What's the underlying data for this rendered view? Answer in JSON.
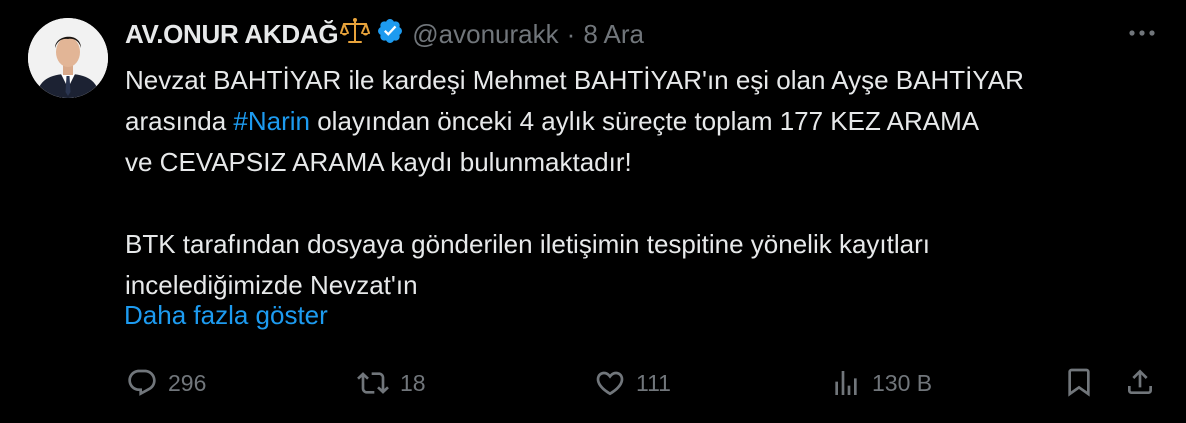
{
  "tweet": {
    "author_name": "AV.ONUR AKDAĞ",
    "handle": "@avonurakk",
    "separator": "·",
    "date": "8 Ara",
    "text_lines": [
      "Nevzat BAHTİYAR ile kardeşi Mehmet BAHTİYAR'ın eşi olan Ayşe BAHTİYAR",
      "arasında ",
      "#Narin",
      " olayından önceki 4 aylık süreçte toplam 177 KEZ ARAMA",
      "ve CEVAPSIZ ARAMA kaydı bulunmaktadır!",
      "BTK tarafından dosyaya gönderilen iletişimin tespitine yönelik kayıtları",
      "incelediğimizde Nevzat'ın"
    ],
    "show_more": "Daha fazla göster",
    "stats": {
      "replies": "296",
      "retweets": "18",
      "likes": "111",
      "views": "130 B"
    }
  },
  "colors": {
    "background": "#000000",
    "text": "#e7e9ea",
    "muted": "#71767b",
    "link": "#1d9bf0",
    "verified": "#1d9bf0"
  },
  "icons": {
    "name_emoji": "balance-scale-icon",
    "verified": "verified-badge-icon",
    "more": "more-options-icon",
    "reply": "reply-icon",
    "retweet": "retweet-icon",
    "like": "like-icon",
    "views": "views-icon",
    "bookmark": "bookmark-icon",
    "share": "share-icon"
  }
}
